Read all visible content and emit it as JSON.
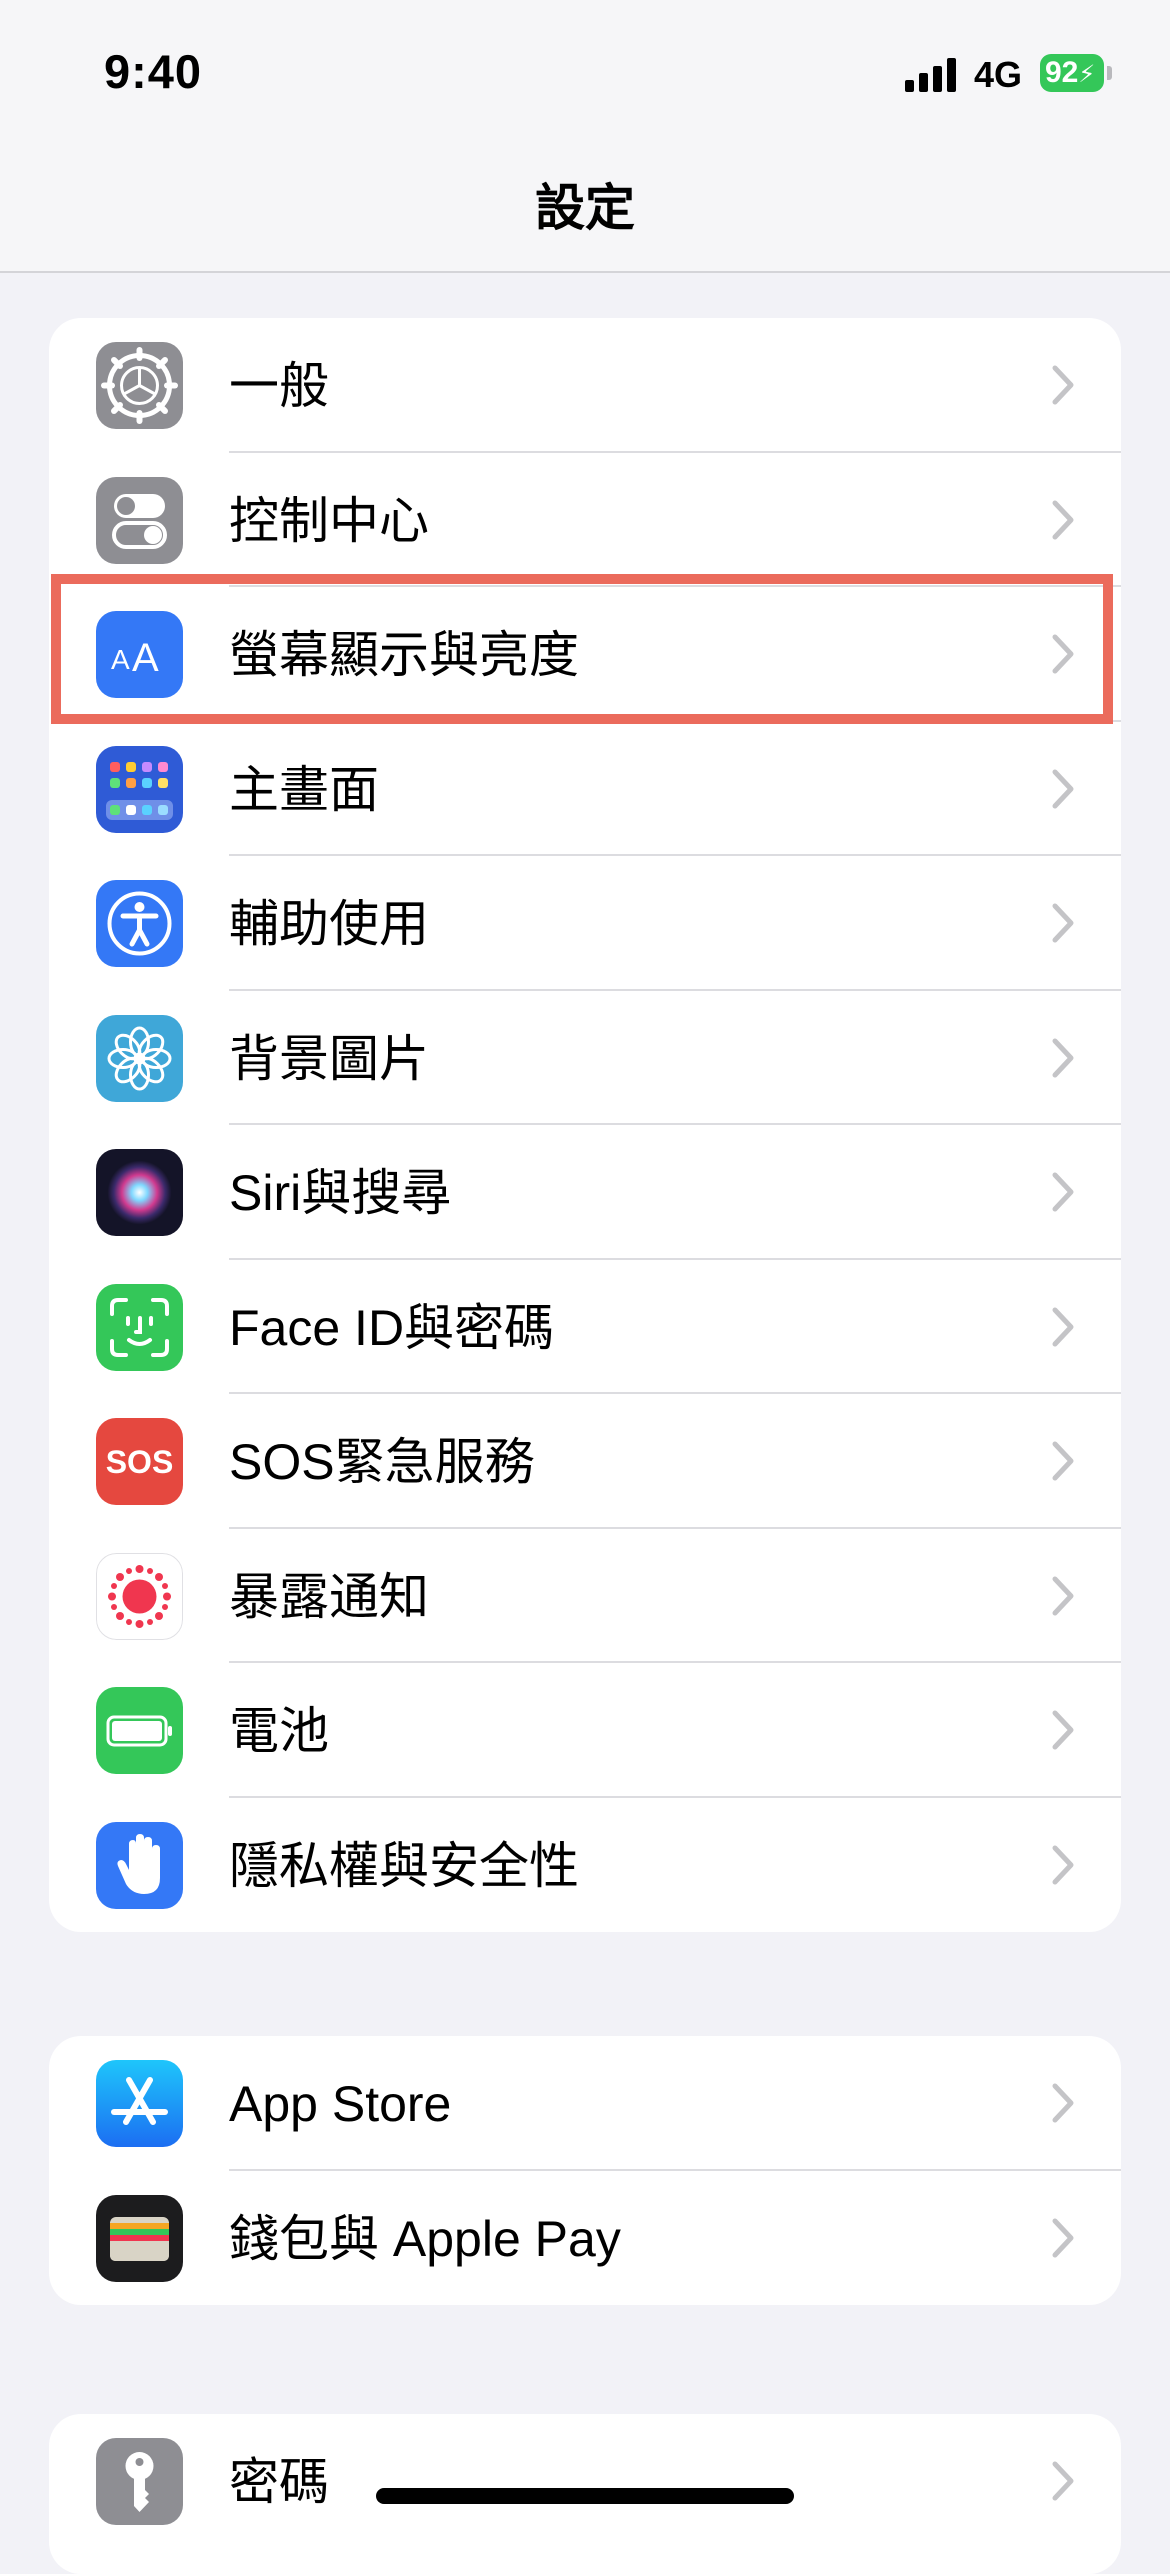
{
  "status_bar": {
    "time": "9:40",
    "network": "4G",
    "battery": "92"
  },
  "nav": {
    "title": "設定"
  },
  "groups": [
    {
      "items": [
        {
          "label": "一般",
          "icon": "gear-icon",
          "color": "#8e8e93"
        },
        {
          "label": "控制中心",
          "icon": "toggle-switches-icon",
          "color": "#8e8e93"
        },
        {
          "label": "螢幕顯示與亮度",
          "icon": "text-size-aa-icon",
          "color": "#3478f6"
        },
        {
          "label": "主畫面",
          "icon": "home-grid-icon",
          "color": "#2f5bd6"
        },
        {
          "label": "輔助使用",
          "icon": "accessibility-icon",
          "color": "#3478f6"
        },
        {
          "label": "背景圖片",
          "icon": "flower-icon",
          "color": "#3fa7d8"
        },
        {
          "label": "Siri與搜尋",
          "icon": "siri-icon",
          "color": "#1a1a2e"
        },
        {
          "label": "Face ID與密碼",
          "icon": "face-id-icon",
          "color": "#34c759"
        },
        {
          "label": "SOS緊急服務",
          "icon": "sos-icon",
          "color": "#e5483f"
        },
        {
          "label": "暴露通知",
          "icon": "exposure-notification-icon",
          "color": "#ffffff"
        },
        {
          "label": "電池",
          "icon": "battery-icon",
          "color": "#34c759"
        },
        {
          "label": "隱私權與安全性",
          "icon": "hand-icon",
          "color": "#3478f6"
        }
      ]
    },
    {
      "items": [
        {
          "label": "App Store",
          "icon": "app-store-icon",
          "color": "#1c8ef9"
        },
        {
          "label": "錢包與 Apple Pay",
          "icon": "wallet-icon",
          "color": "#1c1c1e"
        }
      ]
    },
    {
      "items": [
        {
          "label": "密碼",
          "icon": "key-icon",
          "color": "#8e8e93"
        }
      ]
    }
  ],
  "highlight_color": "#eb6b5c"
}
